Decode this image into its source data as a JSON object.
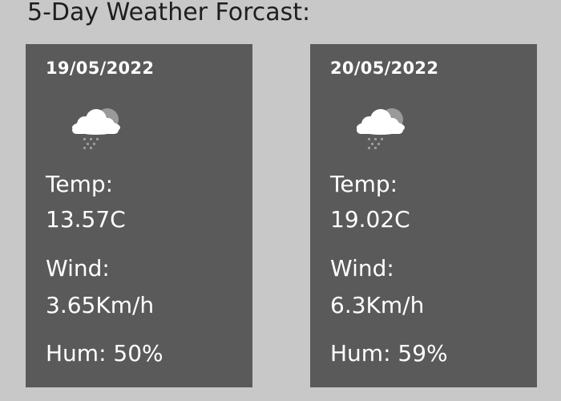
{
  "page": {
    "title": "5-Day Weather Forcast:"
  },
  "colors": {
    "background": "#c8c8c8",
    "card": "#5a5a5a",
    "text_light": "#ffffff",
    "text_dark": "#1e1e1e"
  },
  "forecast": [
    {
      "date": "19/05/2022",
      "icon": "cloud-rain-sun-icon",
      "temp_label": "Temp:",
      "temp_value": "13.57C",
      "wind_label": "Wind:",
      "wind_value": "3.65Km/h",
      "humidity": "Hum: 50%"
    },
    {
      "date": "20/05/2022",
      "icon": "cloud-rain-sun-icon",
      "temp_label": "Temp:",
      "temp_value": "19.02C",
      "wind_label": "Wind:",
      "wind_value": "6.3Km/h",
      "humidity": "Hum: 59%"
    }
  ]
}
